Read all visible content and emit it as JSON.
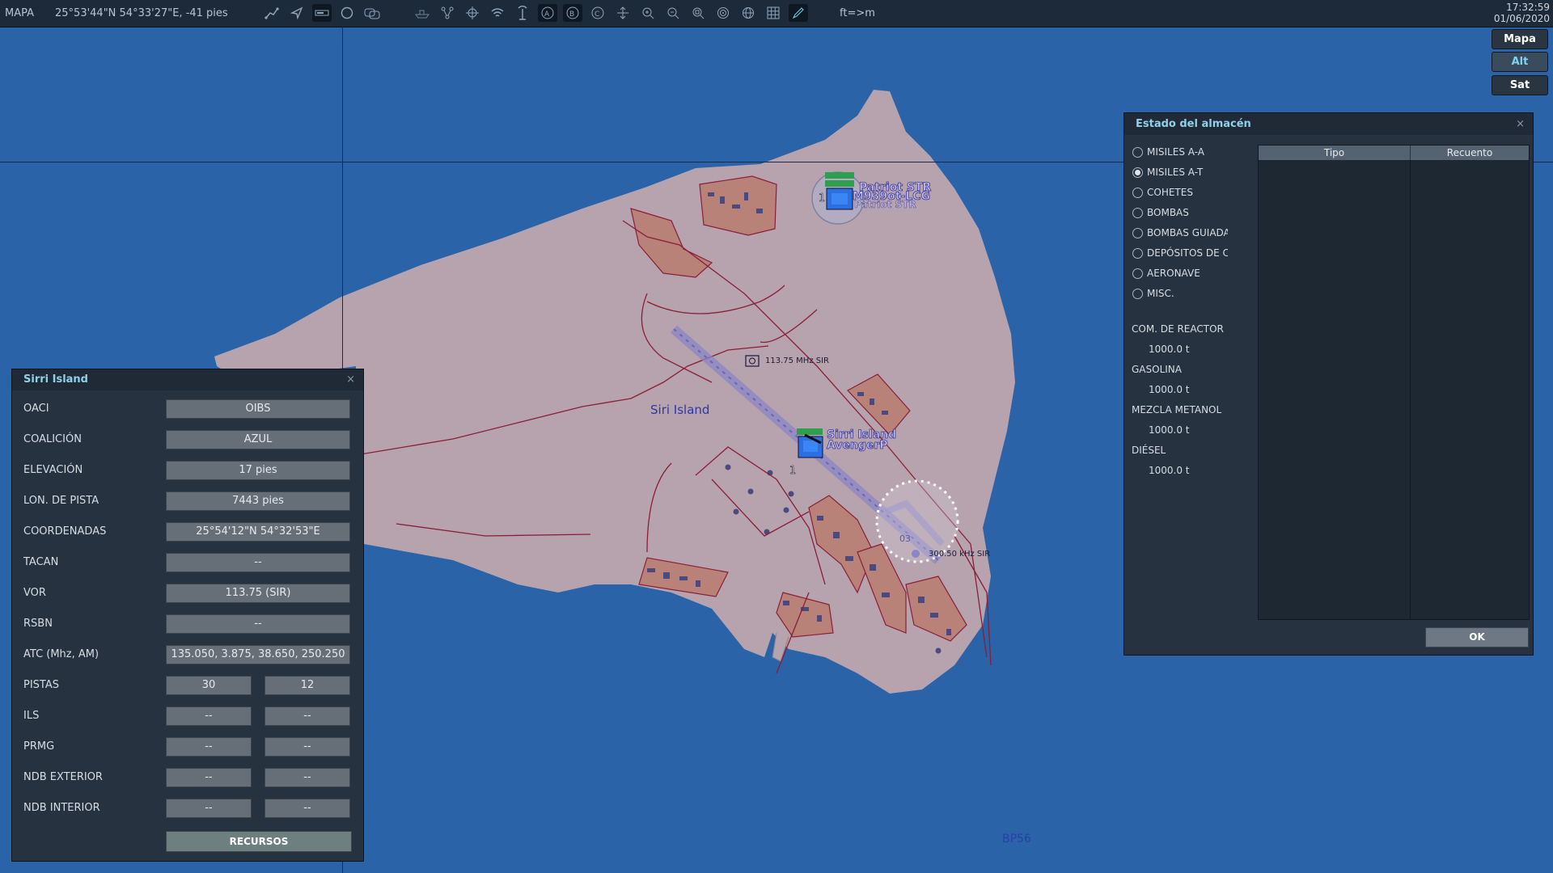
{
  "topbar": {
    "mode": "MAPA",
    "coords": "25°53'44\"N 54°33'27\"E, -41 pies",
    "unit_toggle": "ft=>m",
    "time": "17:32:59",
    "date": "01/06/2020",
    "icons": [
      "route-icon",
      "navigate-icon",
      "ruler-icon",
      "circle-icon",
      "chat-icon",
      "ship-icon",
      "network-icon",
      "crosshair-icon",
      "wifi-icon",
      "antenna-icon",
      "radar-a-icon",
      "radar-b-icon",
      "radar-c-icon",
      "move-icon",
      "zoom-in-icon",
      "zoom-out-icon",
      "zoom-fit-icon",
      "target-icon",
      "globe-icon",
      "grid-icon",
      "pen-icon"
    ]
  },
  "layers": {
    "map": "Mapa",
    "alt": "Alt",
    "sat": "Sat",
    "active": "Alt"
  },
  "map": {
    "island_label": "Siri Island",
    "vor_label": "113.75 MHz SIR",
    "ndb_label": "300.50 kHz SIR",
    "unit_patriot_1": "Patriot STR",
    "unit_patriot_2": "M939ot-LCG",
    "unit_patriot_3": "Patriot STR",
    "unit_airfield_1": "Sirri Island",
    "unit_airfield_2": "AvengerP",
    "runway_end": "03",
    "group_count": "1",
    "grid_label": "BP56",
    "colors": {
      "sea": "#2a63a8",
      "land": "#b7a3ad",
      "built": "#b88278",
      "roads": "#8a1e38"
    }
  },
  "airfield": {
    "title": "Sirri Island",
    "close": "×",
    "rows": [
      {
        "label": "OACI",
        "value": "OIBS"
      },
      {
        "label": "COALICIÓN",
        "value": "AZUL"
      },
      {
        "label": "ELEVACIÓN",
        "value": "17 pies"
      },
      {
        "label": "LON. DE PISTA",
        "value": "7443 pies"
      },
      {
        "label": "COORDENADAS",
        "value": "25°54'12\"N 54°32'53\"E"
      },
      {
        "label": "TACAN",
        "value": "--"
      },
      {
        "label": "VOR",
        "value": "113.75 (SIR)"
      },
      {
        "label": "RSBN",
        "value": "--"
      },
      {
        "label": "ATC  (Mhz, AM)",
        "value": "135.050, 3.875, 38.650, 250.250"
      }
    ],
    "pair_rows": [
      {
        "label": "PISTAS",
        "a": "30",
        "b": "12"
      },
      {
        "label": "ILS",
        "a": "--",
        "b": "--"
      },
      {
        "label": "PRMG",
        "a": "--",
        "b": "--"
      },
      {
        "label": "NDB EXTERIOR",
        "a": "--",
        "b": "--"
      },
      {
        "label": "NDB INTERIOR",
        "a": "--",
        "b": "--"
      }
    ],
    "resources_button": "RECURSOS"
  },
  "warehouse": {
    "title": "Estado del almacén",
    "close": "×",
    "categories": [
      {
        "label": "MISILES A-A",
        "checked": false
      },
      {
        "label": "MISILES A-T",
        "checked": true
      },
      {
        "label": "COHETES",
        "checked": false
      },
      {
        "label": "BOMBAS",
        "checked": false
      },
      {
        "label": "BOMBAS GUIADA",
        "checked": false
      },
      {
        "label": "DEPÓSITOS DE CO",
        "checked": false
      },
      {
        "label": "AERONAVE",
        "checked": false
      },
      {
        "label": "MISC.",
        "checked": false
      }
    ],
    "fuels": [
      {
        "label": "COM. DE REACTOR",
        "value": "1000.0 t"
      },
      {
        "label": "GASOLINA",
        "value": "1000.0 t"
      },
      {
        "label": "MEZCLA METANOL",
        "value": "1000.0 t"
      },
      {
        "label": "DIÉSEL",
        "value": "1000.0 t"
      }
    ],
    "table_headers": [
      "Tipo",
      "Recuento"
    ],
    "ok_button": "OK"
  }
}
